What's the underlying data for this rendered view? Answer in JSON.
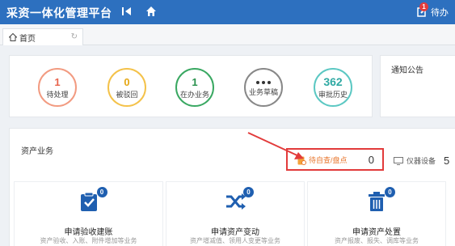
{
  "header": {
    "app_title": "采资一体化管理平台",
    "todo_label": "待办",
    "todo_badge": "1"
  },
  "tabs": [
    {
      "label": "首页"
    }
  ],
  "stats": [
    {
      "value": "1",
      "label": "待处理",
      "color": "#e8644d"
    },
    {
      "value": "0",
      "label": "被驳回",
      "color": "#e5a714"
    },
    {
      "value": "1",
      "label": "在办业务",
      "color": "#28914c"
    },
    {
      "value": "",
      "label": "业务草稿",
      "color": "#333333"
    },
    {
      "value": "362",
      "label": "审批历史",
      "color": "#2fa9a3"
    }
  ],
  "notice": {
    "title": "通知公告"
  },
  "asset_business": {
    "title": "资产业务",
    "self_check": {
      "label": "待自查/盘点",
      "count": "0"
    },
    "devices": {
      "label": "仪器设备",
      "count": "5"
    },
    "cards": [
      {
        "icon": "check-clipboard-icon",
        "badge": "0",
        "title": "申请验收建账",
        "desc": "资产验收、入账、附件增加等业务"
      },
      {
        "icon": "shuffle-icon",
        "badge": "0",
        "title": "申请资产变动",
        "desc": "资产增减值、领用人变更等业务"
      },
      {
        "icon": "trash-icon",
        "badge": "0",
        "title": "申请资产处置",
        "desc": "资产报废、报失、调库等业务"
      }
    ]
  },
  "colors": {
    "header_bg": "#2d70bf",
    "accent_red": "#e23b3b",
    "icon_blue": "#1f5fb0"
  }
}
